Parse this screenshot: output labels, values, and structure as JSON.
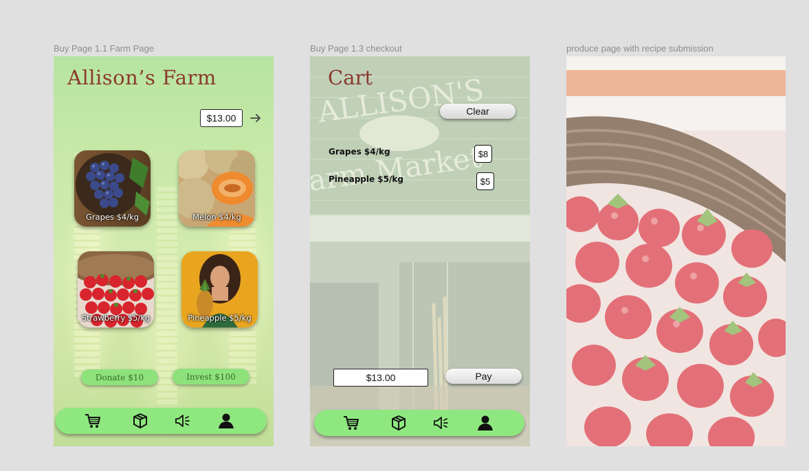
{
  "frames": {
    "farm": {
      "label": "Buy Page 1.1 Farm Page",
      "title": "Allison’s Farm",
      "cart_total": "$13.00",
      "products": [
        {
          "label": "Grapes $4/kg",
          "icon": "grapes-image"
        },
        {
          "label": "Melon $4/kg",
          "icon": "melon-image"
        },
        {
          "label": "Strawberry $5/kg",
          "icon": "strawberry-image"
        },
        {
          "label": "Pineapple $5/kg",
          "icon": "pineapple-image"
        }
      ],
      "donate_label": "Donate $10",
      "invest_label": "Invest $100"
    },
    "checkout": {
      "label": "Buy Page 1.3 checkout",
      "title": "Cart",
      "clear_label": "Clear",
      "items": [
        {
          "name": "Grapes $4/kg",
          "price": "$8"
        },
        {
          "name": "Pineapple $5/kg",
          "price": "$5"
        }
      ],
      "total": "$13.00",
      "pay_label": "Pay",
      "sign_text": "ALLISON'S Farm Market"
    },
    "produce": {
      "label": "produce page with recipe submission"
    }
  },
  "nav": [
    "cart-icon",
    "box-icon",
    "speaker-icon",
    "user-icon"
  ],
  "colors": {
    "accent_green": "#8fe87f",
    "title_brown": "#8b3a2e"
  }
}
